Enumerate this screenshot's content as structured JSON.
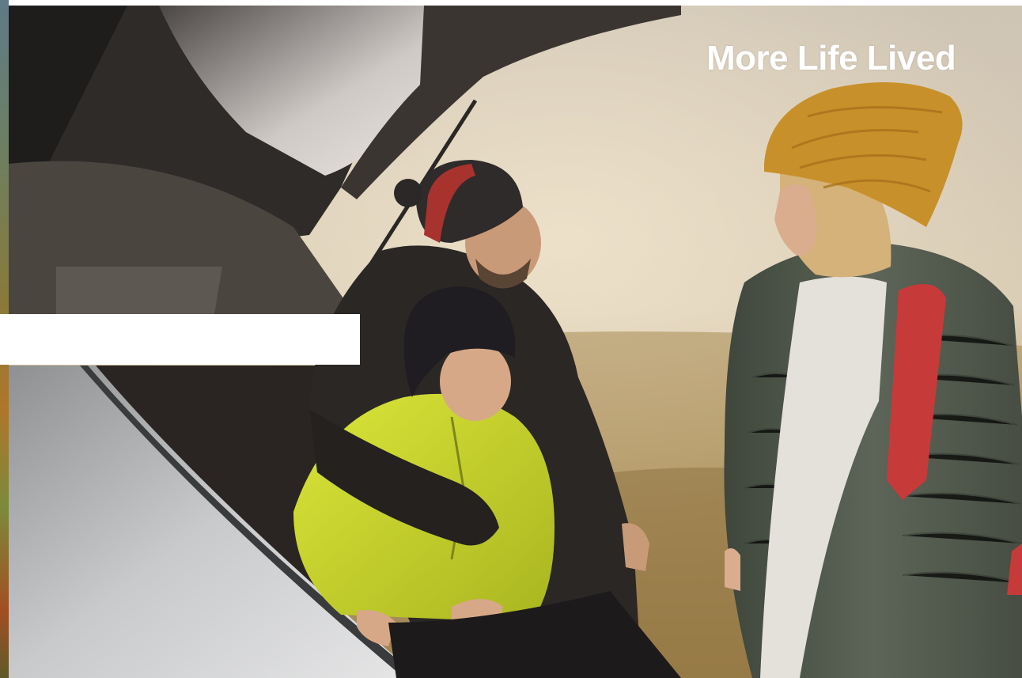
{
  "hero": {
    "title": "More Life Lived",
    "title_color": "#ffffff"
  },
  "photo": {
    "subject_icon": "family-car-trunk-photo",
    "palette": {
      "fog": "#d8ccb8",
      "grass": "#a98a55",
      "mustard_hat": "#c8902a",
      "green_puffer": "#5b6354",
      "yellow_jacket": "#c7d62c",
      "dark_coat": "#2a2724",
      "car_interior": "#3a3632",
      "car_silver": "#b8b8ba",
      "backpack_red": "#c73a3a"
    }
  },
  "overlay_panel": {
    "color": "#ffffff"
  }
}
